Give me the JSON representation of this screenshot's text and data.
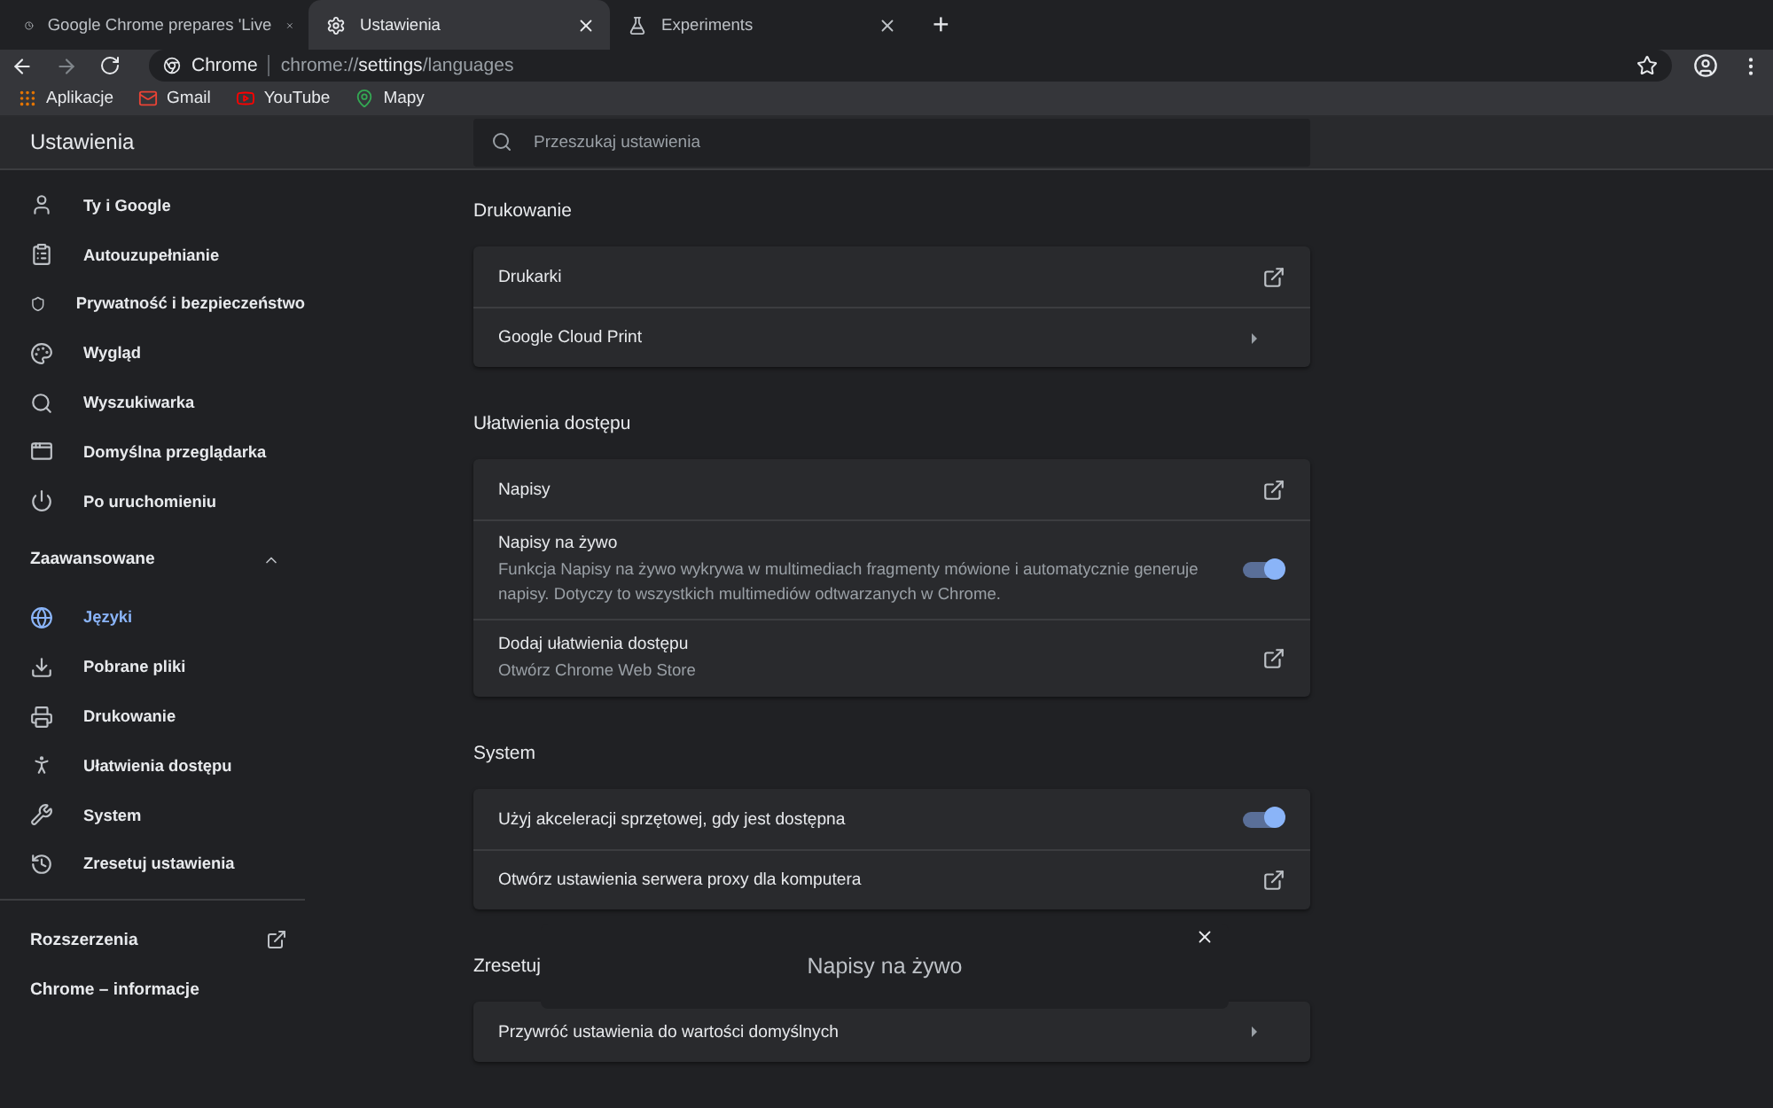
{
  "tabs": [
    {
      "title": "Google Chrome prepares 'Live",
      "selected": false
    },
    {
      "title": "Ustawienia",
      "selected": true
    },
    {
      "title": "Experiments",
      "selected": false
    }
  ],
  "new_tab": "+",
  "address_bar": {
    "origin": "Chrome",
    "url": "chrome://**settings**/languages"
  },
  "bookmarks": [
    {
      "label": "Aplikacje"
    },
    {
      "label": "Gmail"
    },
    {
      "label": "YouTube"
    },
    {
      "label": "Mapy"
    }
  ],
  "header": {
    "title": "Ustawienia",
    "search": {
      "placeholder": "Przeszukaj ustawienia"
    }
  },
  "sidebar": {
    "items": [
      {
        "label": "Ty i Google",
        "selected": false
      },
      {
        "label": "Autouzupełnianie",
        "selected": false
      },
      {
        "label": "Prywatność i bezpieczeństwo",
        "selected": false
      },
      {
        "label": "Wygląd",
        "selected": false
      },
      {
        "label": "Wyszukiwarka",
        "selected": false
      },
      {
        "label": "Domyślna przeglądarka",
        "selected": false
      },
      {
        "label": "Po uruchomieniu",
        "selected": false
      }
    ],
    "advanced": {
      "label": "Zaawansowane",
      "expanded": true,
      "items": [
        {
          "label": "Języki",
          "selected": true
        },
        {
          "label": "Pobrane pliki",
          "selected": false
        },
        {
          "label": "Drukowanie",
          "selected": false
        },
        {
          "label": "Ułatwienia dostępu",
          "selected": false
        },
        {
          "label": "System",
          "selected": false
        },
        {
          "label": "Zresetuj ustawienia",
          "selected": false
        }
      ]
    },
    "footer": [
      {
        "label": "Rozszerzenia",
        "kind": "external"
      },
      {
        "label": "Chrome – informacje",
        "kind": "plain"
      }
    ]
  },
  "sections": [
    {
      "title": "Drukowanie",
      "rows": [
        {
          "kind": "external",
          "label": "Drukarki"
        },
        {
          "kind": "arrow",
          "label": "Google Cloud Print"
        }
      ]
    },
    {
      "title": "Ułatwienia dostępu",
      "rows": [
        {
          "kind": "external",
          "label": "Napisy"
        },
        {
          "kind": "toggle",
          "label": "Napisy na żywo",
          "description": "Funkcja Napisy na żywo wykrywa w multimediach fragmenty mówione i automatycznie generuje napisy. Dotyczy to wszystkich multimediów odtwarzanych w Chrome.",
          "on": true
        },
        {
          "kind": "external",
          "label": "Dodaj ułatwienia dostępu",
          "description": "Otwórz Chrome Web Store"
        }
      ]
    },
    {
      "title": "System",
      "rows": [
        {
          "kind": "toggle",
          "label": "Użyj akceleracji sprzętowej, gdy jest dostępna",
          "on": true
        },
        {
          "kind": "external",
          "label": "Otwórz ustawienia serwera proxy dla komputera"
        }
      ]
    },
    {
      "title": "Zresetuj",
      "rows": [
        {
          "kind": "arrow",
          "label": "Przywróć ustawienia do wartości domyślnych"
        }
      ]
    }
  ],
  "caption_bubble": {
    "text": "Napisy na żywo"
  }
}
